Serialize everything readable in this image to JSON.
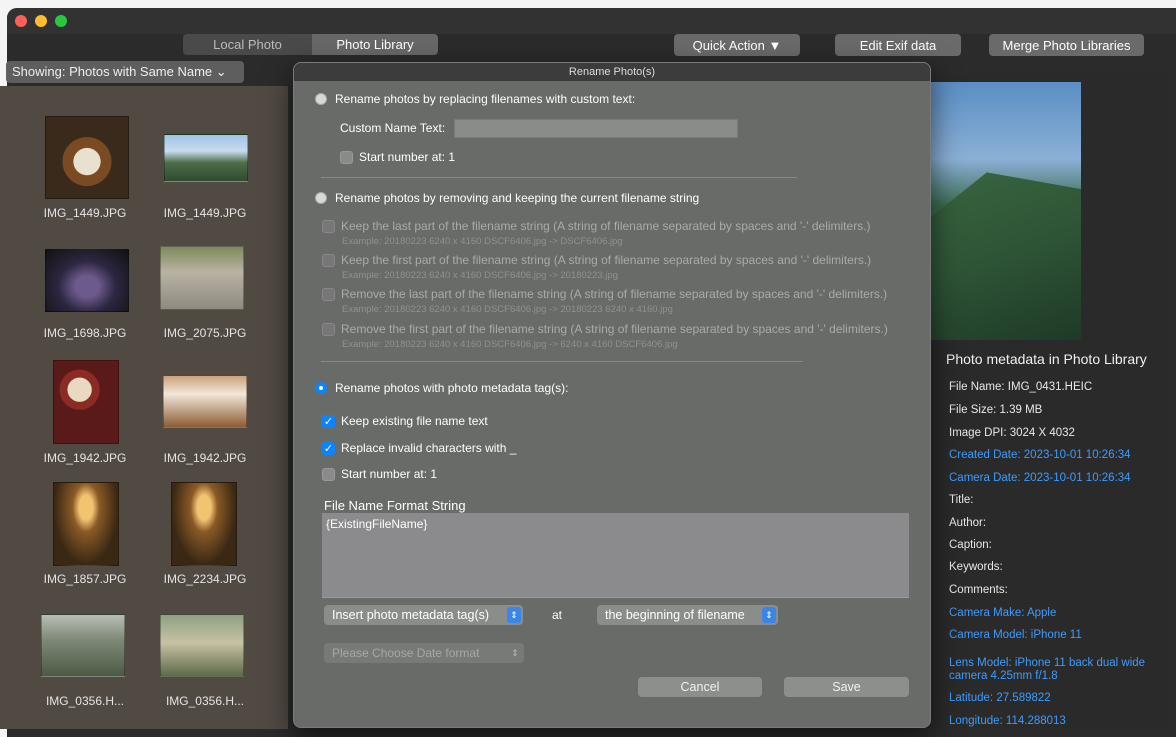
{
  "toolbar": {
    "tab_local": "Local Photo",
    "tab_library": "Photo Library",
    "quick_action": "Quick Action ▼",
    "edit_exif": "Edit Exif data",
    "merge": "Merge Photo Libraries",
    "showing": "Showing: Photos with Same Name ⌄"
  },
  "grid": {
    "labels": [
      "IMG_1449.JPG",
      "IMG_1449.JPG",
      "IMG_1698.JPG",
      "IMG_2075.JPG",
      "IMG_1942.JPG",
      "IMG_1942.JPG",
      "IMG_1857.JPG",
      "IMG_2234.JPG",
      "IMG_0356.H...",
      "IMG_0356.H..."
    ]
  },
  "dialog": {
    "title": "Rename Photo(s)",
    "opt_custom": "Rename photos by replacing filenames with custom text:",
    "custom_name_label": "Custom Name Text:",
    "custom_name_value": "",
    "start_number_1": "Start number at: 1",
    "opt_remove_keep": "Rename photos by removing and keeping the current filename string",
    "keep_last": "Keep the last part of the filename string (A string of filename separated by spaces and '-' delimiters.)",
    "keep_last_ex": "Example: 20180223  6240 x 4160 DSCF6406.jpg  ->  DSCF6406.jpg",
    "keep_first": "Keep the first part of the filename string (A string of filename separated by spaces and '-' delimiters.)",
    "keep_first_ex": "Example: 20180223  6240 x 4160 DSCF6406.jpg  ->  20180223.jpg",
    "remove_last": "Remove the last part of the filename string (A string of filename separated by spaces and '-' delimiters.)",
    "remove_last_ex": "Example: 20180223  6240 x 4160 DSCF6406.jpg  -> 20180223  6240 x 4160.jpg",
    "remove_first": "Remove the first part of the filename string (A string of filename separated by spaces and '-' delimiters.)",
    "remove_first_ex": "Example: 20180223  6240 x 4160 DSCF6406.jpg  -> 6240 x 4160 DSCF6406.jpg",
    "opt_metadata": "Rename photos with photo metadata tag(s):",
    "keep_existing": "Keep existing file name text",
    "replace_invalid": "Replace invalid characters with _",
    "start_number_2": "Start number at: 1",
    "format_label": "File Name Format String",
    "format_value": "{ExistingFileName}",
    "insert_popup": "Insert photo metadata tag(s)",
    "at_label": "at",
    "position_popup": "the beginning of filename",
    "date_popup": "Please Choose Date format",
    "cancel": "Cancel",
    "save": "Save"
  },
  "metadata": {
    "title": "Photo metadata in Photo Library",
    "file_name": "File Name: IMG_0431.HEIC",
    "file_size": "File Size: 1.39 MB",
    "dpi": "Image DPI: 3024 X 4032",
    "created": "Created Date: 2023-10-01 10:26:34",
    "camera_date": "Camera Date: 2023-10-01 10:26:34",
    "title_field": "Title:",
    "author": "Author:",
    "caption": "Caption:",
    "keywords": "Keywords:",
    "comments": "Comments:",
    "make": "Camera Make: Apple",
    "model": "Camera Model: iPhone 11",
    "lens": "Lens Model: iPhone 11 back dual wide camera 4.25mm f/1.8",
    "latitude": "Latitude: 27.589822",
    "longitude": "Longitude: 114.288013"
  },
  "colors": {
    "accent": "#0a84ff",
    "link_blue": "#3d9cff"
  }
}
